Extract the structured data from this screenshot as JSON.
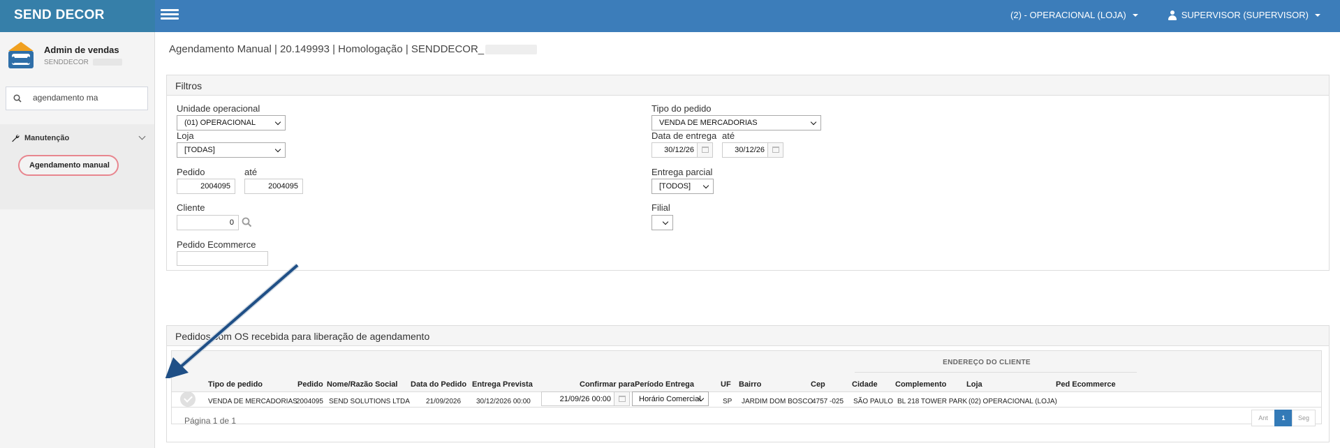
{
  "app": {
    "brand": "SEND DECOR"
  },
  "topbar": {
    "store_menu": "(2) - OPERACIONAL (LOJA)",
    "user_menu": "SUPERVISOR (SUPERVISOR)"
  },
  "sidebar": {
    "profile_name": "Admin de vendas",
    "profile_company": "SENDDECOR",
    "search_value": "agendamento ma",
    "group_label": "Manutenção",
    "active_item": "Agendamento manual"
  },
  "breadcrumb": "Agendamento Manual | 20.149993 | Homologação | SENDDECOR_",
  "filters": {
    "title": "Filtros",
    "unidade_label": "Unidade operacional",
    "unidade_value": "(01) OPERACIONAL",
    "loja_label": "Loja",
    "loja_value": "[TODAS]",
    "pedido_label": "Pedido",
    "pedido_from": "2004095",
    "ate_label": "até",
    "pedido_to": "2004095",
    "cliente_label": "Cliente",
    "cliente_value": "0",
    "pedido_ecommerce_label": "Pedido Ecommerce",
    "pedido_ecommerce_value": "",
    "tipo_label": "Tipo do pedido",
    "tipo_value": "VENDA DE MERCADORIAS",
    "data_entrega_label": "Data de entrega",
    "data_from": "30/12/26",
    "data_to": "30/12/26",
    "entrega_parcial_label": "Entrega parcial",
    "entrega_parcial_value": "[TODOS]",
    "filial_label": "Filial",
    "filial_value": ""
  },
  "orders": {
    "title": "Pedidos com OS recebida para liberação de agendamento",
    "group_header": "ENDEREÇO DO CLIENTE",
    "columns": {
      "tipo": "Tipo de pedido",
      "pedido": "Pedido",
      "nome": "Nome/Razão Social",
      "data_pedido": "Data do Pedido",
      "entrega_prevista": "Entrega Prevista",
      "confirmar_para": "Confirmar para",
      "periodo": "Período Entrega",
      "uf": "UF",
      "bairro": "Bairro",
      "cep": "Cep",
      "cidade": "Cidade",
      "complemento": "Complemento",
      "loja": "Loja",
      "ped_ecommerce": "Ped Ecommerce"
    },
    "row": {
      "tipo": "VENDA DE MERCADORIAS",
      "pedido": "2004095",
      "nome": "SEND SOLUTIONS LTDA",
      "data_pedido": "21/09/2026",
      "entrega_prevista": "30/12/2026 00:00",
      "confirmar_para": "21/09/26 00:00",
      "periodo": "Horário Comercial",
      "uf": "SP",
      "bairro": "JARDIM DOM BOSCO",
      "cep": "4757 -025",
      "cidade": "SÃO PAULO",
      "complemento": "BL 218 TOWER PARK",
      "loja": "(02) OPERACIONAL (LOJA)",
      "ped_ecommerce": ""
    },
    "pagination": {
      "text": "Página 1 de 1",
      "prev": "Ant",
      "current": "1",
      "next": "Seg"
    }
  },
  "colors": {
    "topbar": "#3c7dba",
    "brand_bg": "#367fa9",
    "highlight": "#e8868f",
    "arrow": "#1f4f86",
    "active_page": "#337ab7"
  }
}
